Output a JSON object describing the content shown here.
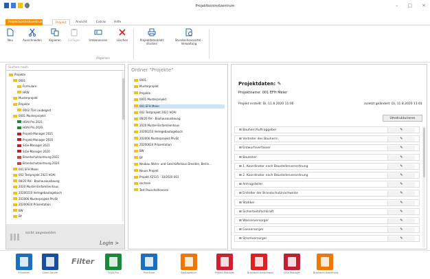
{
  "window": {
    "title": "Projektkontrollzentrum",
    "controls": [
      "–",
      "□",
      "×"
    ]
  },
  "menu": {
    "tabs": [
      "Projektkontrollzentrum",
      "Projekt",
      "Ansicht",
      "Extras",
      "Hilfe"
    ]
  },
  "ribbon": {
    "buttons": [
      "Neu",
      "Ausschneiden",
      "Kopieren",
      "Einfügen",
      "Umbenennen",
      "Löschen",
      "Projektdatenblatt drucken",
      "Stundenhonorartel - Verwaltung"
    ],
    "group": "Allgemein"
  },
  "left": {
    "search_placeholder": "Suchen nach",
    "tree": [
      "Projekte",
      "0001",
      "Formulare",
      "HRW",
      "Musterprojekt",
      "Projekte",
      "0002 TLH Laubegast",
      "0001 Musterprojekt",
      "HOAI Pro 2021",
      "HOAI Pro 2020",
      "Projekt-Manager 2021",
      "Projekt-Manager 2020",
      "SiGe-Manager 2021",
      "SiGe-Manager 2020",
      "Brandschutzordnung 2021",
      "Brandschutzordnung 2020",
      "001 EFH Meier",
      "002 Testprojekt 2021 HOAI",
      "08/20 RH - Bauhausausbaung",
      "2020 Muster-Einfamilienhaus",
      "20200210 Verlegebautagebuch",
      "202006 Musterprojekt PhvSt",
      "20200624 Präsentation",
      "BW",
      "BY"
    ],
    "login_status": "nicht angemeldet",
    "login_button": "Login >"
  },
  "middle": {
    "header": "Ordner \"Projekte\"",
    "items": [
      "0001",
      "Musterprojekt",
      "Projekte",
      "0001 Musterprojekt",
      "001 EFH Meier",
      "002 Testprojekt 2021 HOAI",
      "08/20 RH - Bauhausausbaung",
      "2020 Muster-Einfamilienhaus",
      "20200210 Verlegebautagebuch",
      "202006 Musterprojekt PhvSt",
      "20200624 Präsentation",
      "BW",
      "BY",
      "Neubau Wohn- und Geschäftshaus Dresden, Berlin...",
      "Neues Projekt",
      "Projekt X2515 - 10/2020 001",
      "sachsen",
      "Test Pauschalhonorar"
    ],
    "selected": 4
  },
  "right": {
    "heading": "Projektdaten:",
    "project_name": "Projektname:  001 EFH Meier",
    "created": "Projekt erstellt: Di, 11.8.2020 11:00",
    "changed": "zuletzt geändert: Di, 11.8.2020 11:01",
    "restructure_button": "Umstrukturieren",
    "rows": [
      "Bauherr/Auftraggeber",
      "Vertreter des Bauherrn",
      "Entwurfsverfasser",
      "Bauleiter",
      "1. Koordinator nach Baustellenverordnung",
      "2. Koordinator nach Baustellenverordnung",
      "Antragsteller",
      "Ersteller der Brandschutznachweise",
      "Statiker",
      "Sicherheitsfachkraft",
      "Wasserversorger",
      "Gasversorger",
      "Stromversorger"
    ],
    "row_prefix": "⊞",
    "edit_symbol": "✎"
  },
  "bottom": {
    "apps": [
      "Einstellen",
      "Client-Server",
      "HOAI-Pro",
      "PrintForm",
      "Bautagebuch",
      "Projekt-Manager",
      "Brandschutznachweis",
      "SiGe-Manager",
      "Brandschutzordnung"
    ],
    "filter_label": "Filter"
  },
  "colors": {
    "accent": "#f29200",
    "selection": "#cde4f7",
    "folder": "#f0c020"
  }
}
